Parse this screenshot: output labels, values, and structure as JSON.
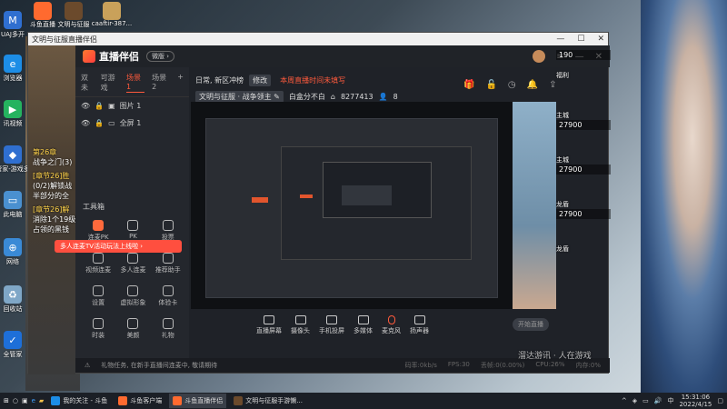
{
  "desktop": {
    "top_icons": [
      {
        "label": "斗鱼直播",
        "color": "#ff6a2f"
      },
      {
        "label": "文明与征服",
        "color": "#6b4a2c"
      },
      {
        "label": "caaftir-387...",
        "color": "#c9a15a"
      }
    ],
    "left_icons": [
      {
        "label": "UAJ多开",
        "color": "#2f6fd0",
        "glyph": "M"
      },
      {
        "label": "浏览器",
        "color": "#1c8de6",
        "glyph": "e"
      },
      {
        "label": "讯视频",
        "color": "#25b35f",
        "glyph": "▶"
      },
      {
        "label": "管家-游戏多",
        "color": "#2f6fd0",
        "glyph": "◆"
      },
      {
        "label": "此电脑",
        "color": "#4a90d0",
        "glyph": "▭"
      },
      {
        "label": "网络",
        "color": "#3a8ad6",
        "glyph": "⊕"
      },
      {
        "label": "回收站",
        "color": "#7fa7c7",
        "glyph": "♻"
      },
      {
        "label": "全管家",
        "color": "#1e6fd8",
        "glyph": "✓"
      }
    ]
  },
  "game_left": {
    "lines": [
      "第26章",
      "战争之门(3)",
      "[章节26]胜",
      "(0/2)解锁战",
      "半部分的全",
      "[章节26]解",
      "消除1个19级",
      "占领的黑钱"
    ]
  },
  "game_hud": {
    "top_value": "190",
    "welfare_label": "福利",
    "entries": [
      {
        "label": "主城",
        "value": "27900"
      },
      {
        "label": "主城",
        "value": "27900"
      },
      {
        "label": "龙盾",
        "value": "27900"
      },
      {
        "label": "龙盾",
        "value": ""
      }
    ]
  },
  "window": {
    "title": "文明与征服直播伴侣",
    "brand": "直播伴侣",
    "version_pill": "微版 ›",
    "scene_tabs": [
      "双未",
      "可游戏",
      "场景 1",
      "场景 2",
      "+"
    ],
    "layers": [
      {
        "name": "图片 1"
      },
      {
        "name": "全屏 1"
      }
    ],
    "tools_title": "工具箱",
    "tools": [
      {
        "label": "连麦PK",
        "highlight": true
      },
      {
        "label": "PK"
      },
      {
        "label": "投票"
      },
      {
        "label": "视频连麦"
      },
      {
        "label": "多人连麦"
      },
      {
        "label": "推荐助手"
      },
      {
        "label": "设置"
      },
      {
        "label": "虚拟形象"
      },
      {
        "label": "体验卡"
      },
      {
        "label": "时装"
      },
      {
        "label": "美颜"
      },
      {
        "label": "礼物"
      }
    ],
    "promo_text": "多人连麦TV活动玩法上线啦 ›",
    "room": {
      "category": "日常, 新区冲榜",
      "edit": "修改",
      "warning": "本周直播时间未填写",
      "tags": [
        "文明与征服 · 战争领主 ✎"
      ],
      "summary": "白盒分不白",
      "room_id": "8277413",
      "viewers": "8"
    },
    "controls": [
      {
        "label": "直播屏幕"
      },
      {
        "label": "摄像头"
      },
      {
        "label": "手机投屏"
      },
      {
        "label": "多媒体"
      },
      {
        "label": "麦克风"
      },
      {
        "label": "扬声器"
      }
    ],
    "live_button": "开始直播",
    "status_left": "礼物任务, 在新手直播间连麦中, 敬请期待",
    "status_right": [
      "码率:0kb/s",
      "FPS:30",
      "丢帧:0(0.00%)",
      "CPU:26%",
      "内存:0%"
    ]
  },
  "taskbar": {
    "items": [
      {
        "label": "我的关注 - 斗鱼",
        "color": "#1c8de6",
        "active": false
      },
      {
        "label": "斗鱼客户端",
        "color": "#ff6a2f",
        "active": false
      },
      {
        "label": "斗鱼直播伴侣",
        "color": "#ff6a2f",
        "active": true
      },
      {
        "label": "文明与征服手游懒...",
        "color": "#6b4a2c",
        "active": false
      }
    ],
    "time": "15:31:06",
    "date": "2022/4/15"
  },
  "watermark": "溜达游讯 · 人在游戏"
}
